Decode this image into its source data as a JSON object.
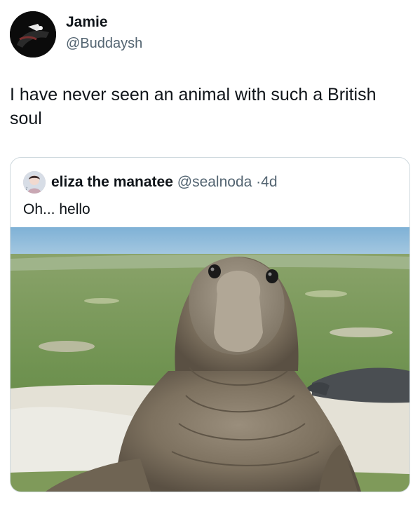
{
  "tweet": {
    "author_name": "Jamie",
    "author_handle": "@Buddaysh",
    "text": "I have never seen an animal with such a British soul"
  },
  "quoted_tweet": {
    "author_name": "eliza the manatee",
    "author_handle": "@sealnoda",
    "separator": "·",
    "age": "4d",
    "text": "Oh... hello"
  },
  "colors": {
    "primary_text": "#0f1419",
    "secondary_text": "#536471",
    "border": "#cfd9de"
  },
  "icons": [
    "avatar",
    "quoted-avatar"
  ]
}
